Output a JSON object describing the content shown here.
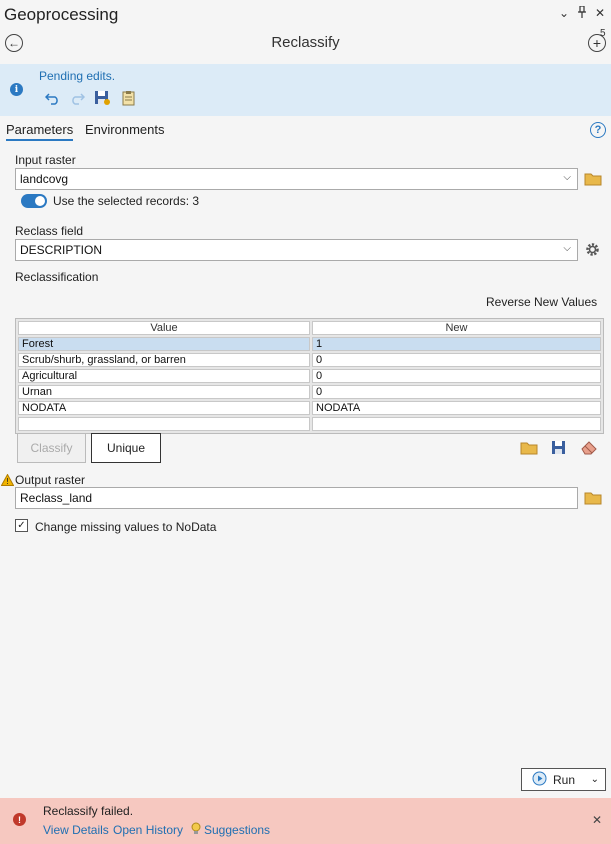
{
  "window": {
    "title": "Geoprocessing",
    "controls": {
      "dropdown": "⌄",
      "pin": "📌",
      "close": "✕"
    }
  },
  "header": {
    "back_label": "←",
    "tool_title": "Reclassify",
    "add_label": "+",
    "add_badge": "5"
  },
  "banner": {
    "message": "Pending edits.",
    "info_glyph": "i"
  },
  "tabs": [
    {
      "label": "Parameters",
      "active": true
    },
    {
      "label": "Environments",
      "active": false
    }
  ],
  "help_glyph": "?",
  "input_raster": {
    "label": "Input raster",
    "value": "landcovg"
  },
  "selected_records": {
    "label": "Use the selected records: 3",
    "enabled": true
  },
  "reclass_field": {
    "label": "Reclass field",
    "value": "DESCRIPTION"
  },
  "reclassification": {
    "label": "Reclassification",
    "reverse_label": "Reverse New Values",
    "columns": [
      "Value",
      "New"
    ],
    "rows": [
      {
        "value": "Forest",
        "new": "1",
        "selected": true
      },
      {
        "value": "Scrub/shurb, grassland, or barren",
        "new": "0",
        "selected": false
      },
      {
        "value": "Agricultural",
        "new": "0",
        "selected": false
      },
      {
        "value": "Urnan",
        "new": "0",
        "selected": false
      },
      {
        "value": "NODATA",
        "new": "NODATA",
        "selected": false
      },
      {
        "value": "",
        "new": "",
        "selected": false
      }
    ],
    "classify_label": "Classify",
    "unique_label": "Unique"
  },
  "output_raster": {
    "label": "Output raster",
    "value": "Reclass_land",
    "warning_glyph": "!"
  },
  "missing_values": {
    "label": "Change missing values to NoData",
    "checked": true,
    "check_glyph": "✓"
  },
  "run": {
    "label": "Run",
    "arrow": "⌄"
  },
  "error": {
    "message": "Reclassify failed.",
    "glyph": "!",
    "close": "✕",
    "links": {
      "details": "View Details",
      "history": "Open History",
      "suggestions": "Suggestions"
    }
  },
  "colors": {
    "accent": "#2b79c2",
    "banner_bg": "#dcebf7",
    "error_bg": "#f6c8c0",
    "selected_row": "#c9ddf0"
  }
}
